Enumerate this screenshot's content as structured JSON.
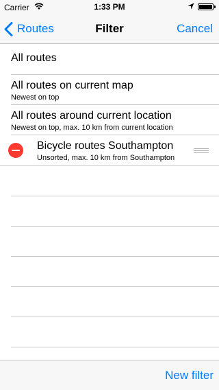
{
  "status": {
    "carrier": "Carrier",
    "time": "1:33 PM"
  },
  "nav": {
    "back_label": "Routes",
    "title": "Filter",
    "cancel_label": "Cancel"
  },
  "rows": [
    {
      "title": "All routes",
      "subtitle": ""
    },
    {
      "title": "All routes on current map",
      "subtitle": "Newest on top"
    },
    {
      "title": "All routes around current location",
      "subtitle": "Newest on top, max. 10 km from current location"
    },
    {
      "title": "Bicycle routes Southampton",
      "subtitle": "Unsorted, max. 10 km from Southampton"
    }
  ],
  "toolbar": {
    "new_filter_label": "New filter"
  },
  "colors": {
    "tint": "#007aff",
    "delete": "#ff3b30",
    "separator": "#c8c7cc",
    "bar": "#f7f7f7"
  },
  "icons": [
    "wifi-icon",
    "location-arrow-icon",
    "battery-icon",
    "chevron-left-icon",
    "delete-circle-icon",
    "reorder-handle-icon"
  ]
}
